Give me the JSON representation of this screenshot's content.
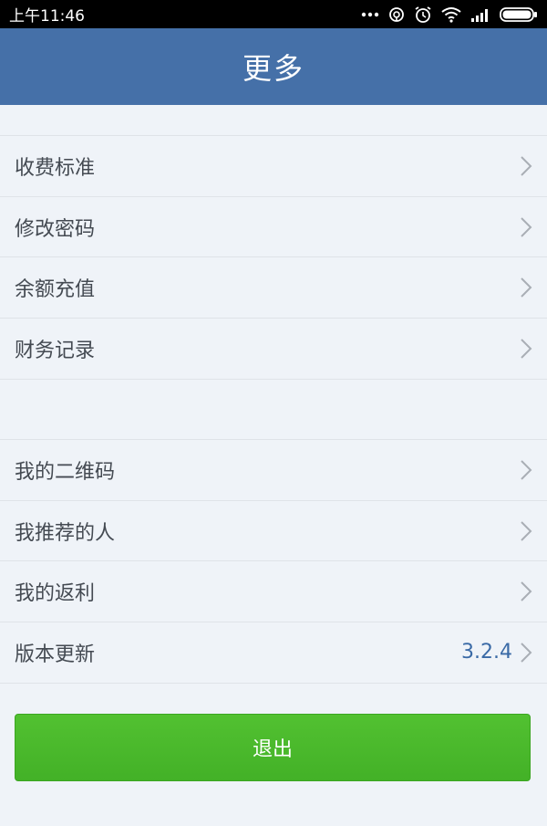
{
  "status_bar": {
    "time": "上午11:46",
    "icons": [
      "more-dots-icon",
      "sync-icon",
      "alarm-icon",
      "wifi-icon",
      "signal-icon",
      "battery-icon"
    ]
  },
  "header": {
    "title": "更多"
  },
  "group1": {
    "items": [
      {
        "label": "收费标准"
      },
      {
        "label": "修改密码"
      },
      {
        "label": "余额充值"
      },
      {
        "label": "财务记录"
      }
    ]
  },
  "group2": {
    "items": [
      {
        "label": "我的二维码"
      },
      {
        "label": "我推荐的人"
      },
      {
        "label": "我的返利"
      },
      {
        "label": "版本更新",
        "value": "3.2.4"
      }
    ]
  },
  "logout": {
    "label": "退出"
  },
  "colors": {
    "header": "#4570a8",
    "background": "#eff3f8",
    "button": "#4cb82c",
    "version_text": "#3a6aa6"
  }
}
